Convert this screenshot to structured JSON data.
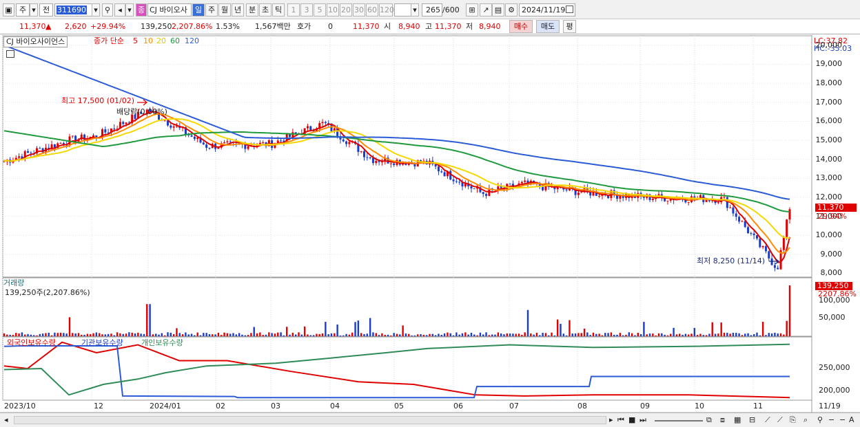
{
  "toolbar": {
    "market": "주",
    "prev": "전",
    "code": "311690",
    "name": "CJ 바이오사",
    "chart_mode": "종",
    "periods": [
      "일",
      "주",
      "월",
      "년",
      "분",
      "초",
      "틱"
    ],
    "intervals": [
      "1",
      "3",
      "5",
      "10",
      "20",
      "30",
      "60",
      "120"
    ],
    "count": "265",
    "count_total": "/600",
    "date": "2024/11/19"
  },
  "quote": {
    "price": "11,370",
    "change": "2,620",
    "change_arrow": "▲",
    "change_pct": "+29.94%",
    "volume": "139,250",
    "volume_ratio": "2,207.86%",
    "turnover_pct": "1.53%",
    "amount": "1,567백만",
    "quote_label": "호가",
    "quote_value": "0",
    "quote_price": "11,370",
    "open_label": "시",
    "open": "8,940",
    "high_label": "고",
    "high": "11,370",
    "low_label": "저",
    "low": "8,940",
    "buy": "매수",
    "sell": "매도",
    "eval": "평"
  },
  "legend": {
    "stock_name": "CJ 바이오사이언스",
    "ma_label": "종가 단순",
    "ma_periods": [
      "5",
      "10",
      "20",
      "60",
      "120"
    ],
    "ma_colors": [
      "#e00000",
      "#ff8c00",
      "#f5d800",
      "#1e9a3c",
      "#2a5bd7"
    ],
    "lc": "LC:37.82",
    "hc": "HC:-35.03"
  },
  "annotations": {
    "high": "최고 17,500 (01/02)",
    "dividend": "배당락(0.00%)",
    "low": "최저 8,250 (11/14)"
  },
  "price_axis": {
    "ticks": [
      "20,000",
      "19,000",
      "18,000",
      "17,000",
      "16,000",
      "15,000",
      "14,000",
      "13,000",
      "12,000",
      "11,000",
      "10,000",
      "9,000",
      "8,000"
    ],
    "current": "11,370",
    "current_pct": "29.94%"
  },
  "volume_panel": {
    "title": "거래량",
    "subtitle": "139,250주(2,207.86%)",
    "ticks": [
      "100,000",
      "50,000"
    ],
    "current": "139,250",
    "current_pct": "2207.86%"
  },
  "holdings_panel": {
    "series_labels": [
      "외국인보유수량",
      "기관보유수량",
      "개인보유수량"
    ],
    "series_colors": [
      "#e00000",
      "#2a5bd7",
      "#2e8b57"
    ],
    "ticks": [
      "250,000",
      "200,000"
    ]
  },
  "x_axis": {
    "labels": [
      "2023/10",
      "12",
      "2024/01",
      "02",
      "03",
      "04",
      "05",
      "06",
      "07",
      "08",
      "09",
      "10",
      "11",
      "11/19"
    ]
  },
  "chart_data": [
    {
      "type": "line",
      "title": "",
      "series_name": "CJ 바이오사이언스",
      "x": [
        "2023/10",
        "2023/11",
        "2023/12",
        "2024/01",
        "2024/02",
        "2024/03",
        "2024/04",
        "2024/05",
        "2024/06",
        "2024/07",
        "2024/08",
        "2024/09",
        "2024/10",
        "2024/11/14",
        "2024/11/19"
      ],
      "close": [
        13900,
        15000,
        15200,
        16600,
        14700,
        14800,
        15900,
        14000,
        13800,
        12200,
        12700,
        12300,
        12000,
        8250,
        11370
      ],
      "ylim": [
        7800,
        20500
      ]
    },
    {
      "type": "bar",
      "title": "거래량",
      "values_note_latest": 139250,
      "ylim": [
        0,
        160000
      ]
    },
    {
      "type": "line",
      "series": [
        {
          "name": "외국인보유수량",
          "start": 245000,
          "end": 190000
        },
        {
          "name": "기관보유수량",
          "start": 280000,
          "end": 228000
        },
        {
          "name": "개인보유수량",
          "start": 240000,
          "end": 285000
        }
      ],
      "ylim": [
        180000,
        300000
      ]
    }
  ]
}
